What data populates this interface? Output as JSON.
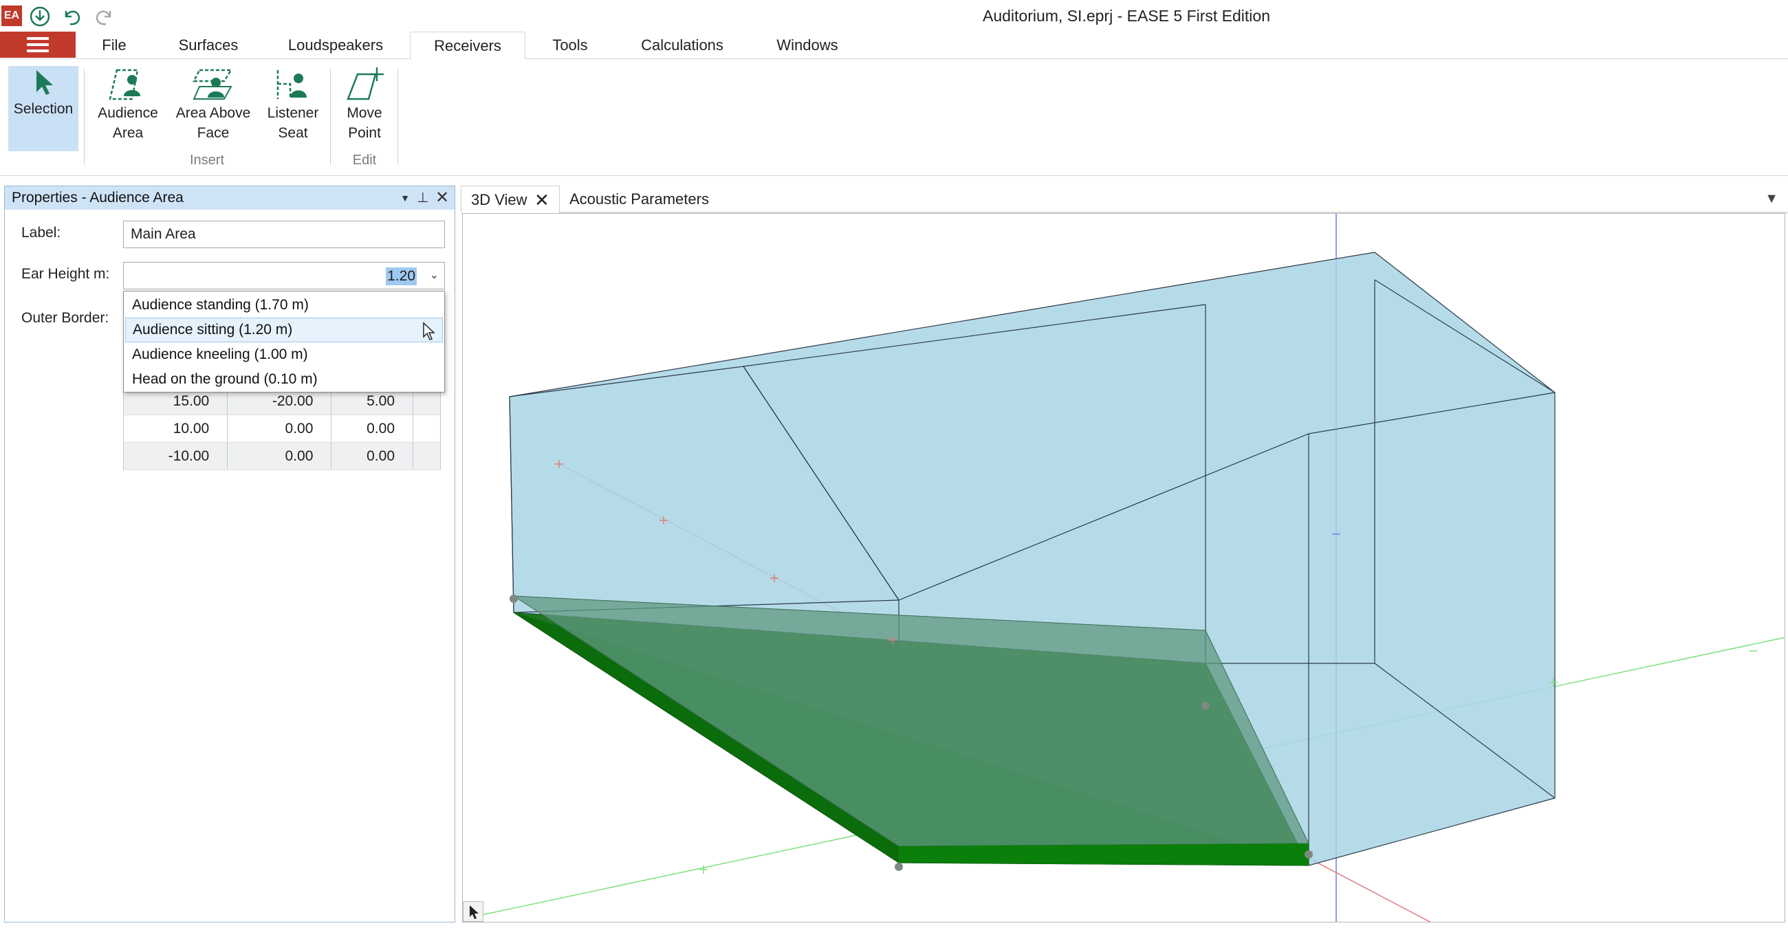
{
  "app": {
    "window_title": "Auditorium, SI.eprj - EASE 5 First Edition",
    "logo_text": "EA"
  },
  "quick_access": [
    "save-icon",
    "undo-icon",
    "redo-icon"
  ],
  "menu": {
    "tabs": [
      "File",
      "Surfaces",
      "Loudspeakers",
      "Receivers",
      "Tools",
      "Calculations",
      "Windows"
    ],
    "active": "Receivers"
  },
  "ribbon": {
    "selection": "Selection",
    "audience_area": [
      "Audience",
      "Area"
    ],
    "area_above_face": [
      "Area Above",
      "Face"
    ],
    "listener_seat": [
      "Listener",
      "Seat"
    ],
    "move_point": [
      "Move",
      "Point"
    ],
    "group_insert": "Insert",
    "group_edit": "Edit"
  },
  "properties": {
    "title": "Properties - Audience Area",
    "label_caption": "Label:",
    "label_value": "Main Area",
    "ear_height_caption": "Ear Height m:",
    "ear_height_value": "1.20",
    "outer_border_caption": "Outer Border:",
    "dropdown_options": [
      "Audience standing (1.70 m)",
      "Audience sitting (1.20 m)",
      "Audience kneeling (1.00 m)",
      "Head on the ground (0.10 m)"
    ],
    "hovered_option": "Audience sitting (1.20 m)",
    "border_rows": [
      [
        "15.00",
        "-20.00",
        "5.00"
      ],
      [
        "10.00",
        "0.00",
        "0.00"
      ],
      [
        "-10.00",
        "0.00",
        "0.00"
      ]
    ]
  },
  "view": {
    "tabs": [
      "3D View",
      "Acoustic Parameters"
    ],
    "active": "3D View"
  },
  "colors": {
    "accent_red": "#c23a2b",
    "ribbon_green": "#1e7a56",
    "panel_header": "#cfe3f7",
    "room_fill": "#a8d4e2",
    "audience_green": "#0a7a0a"
  }
}
